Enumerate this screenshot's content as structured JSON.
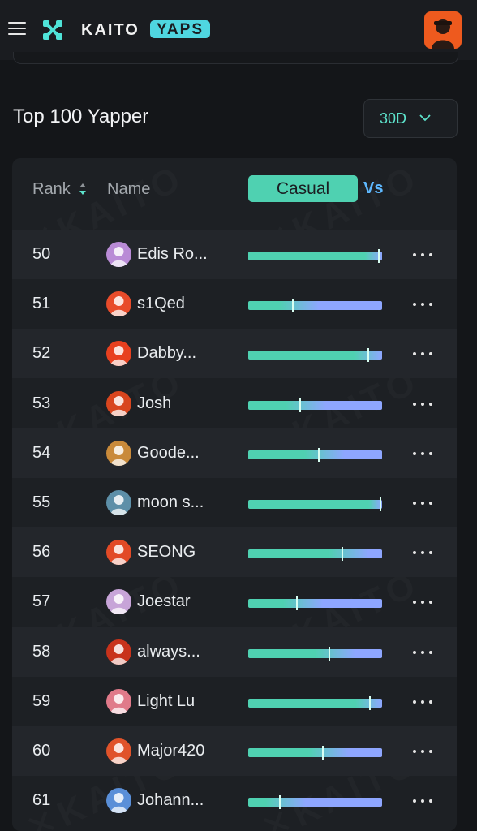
{
  "header": {
    "brand": "KAITO",
    "badge": "YAPS",
    "menu_icon": "hamburger-menu-icon",
    "logo_icon": "kaito-logo-icon"
  },
  "section": {
    "title": "Top 100 Yapper",
    "period": "30D"
  },
  "table": {
    "col_rank": "Rank",
    "col_name": "Name",
    "casual_label": "Casual",
    "vs_label": "Vs",
    "rows": [
      {
        "rank": "50",
        "name": "Edis Ro...",
        "avatar_color": "#b98bd6",
        "score": 0.97
      },
      {
        "rank": "51",
        "name": "s1Qed",
        "avatar_color": "#e84b2a",
        "score": 0.33
      },
      {
        "rank": "52",
        "name": "Dabby...",
        "avatar_color": "#e8401f",
        "score": 0.89
      },
      {
        "rank": "53",
        "name": "Josh",
        "avatar_color": "#d8451e",
        "score": 0.38
      },
      {
        "rank": "54",
        "name": "Goode...",
        "avatar_color": "#c98a3a",
        "score": 0.52
      },
      {
        "rank": "55",
        "name": "moon s...",
        "avatar_color": "#5d8fa8",
        "score": 1.0
      },
      {
        "rank": "56",
        "name": "SEONG",
        "avatar_color": "#e24a26",
        "score": 0.7
      },
      {
        "rank": "57",
        "name": "Joestar",
        "avatar_color": "#c7a4d8",
        "score": 0.36
      },
      {
        "rank": "58",
        "name": "always...",
        "avatar_color": "#c8321b",
        "score": 0.6
      },
      {
        "rank": "59",
        "name": "Light Lu",
        "avatar_color": "#e07a8a",
        "score": 0.9
      },
      {
        "rank": "60",
        "name": "Major420",
        "avatar_color": "#e0532a",
        "score": 0.55
      },
      {
        "rank": "61",
        "name": "Johann...",
        "avatar_color": "#5a8fd8",
        "score": 0.23
      }
    ]
  },
  "colors": {
    "accent_green": "#4fd1b1",
    "accent_blue": "#8ea6ff",
    "badge": "#4fd6e0",
    "background": "#141619",
    "panel": "#1d2024"
  }
}
